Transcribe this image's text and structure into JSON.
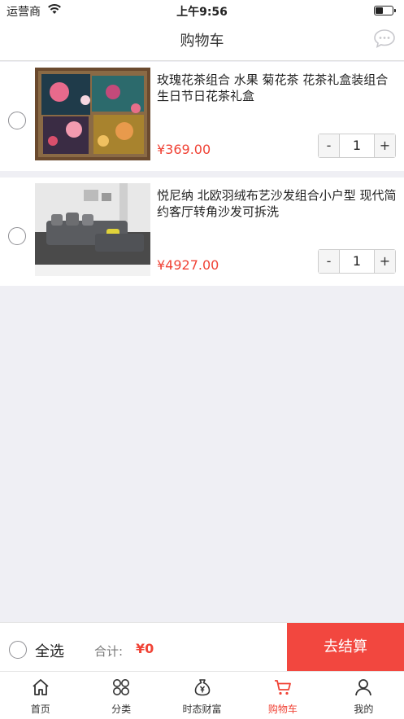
{
  "status_bar": {
    "carrier": "运营商",
    "time": "上午9:56",
    "battery_level": 0.4
  },
  "nav": {
    "title": "购物车",
    "chat_icon": "chat-bubble-icon"
  },
  "cart": {
    "items": [
      {
        "title": "玫瑰花茶组合 水果 菊花茶 花茶礼盒装组合 生日节日花茶礼盒",
        "price": "¥369.00",
        "qty": "1",
        "minus": "-",
        "plus": "+"
      },
      {
        "title": "悦尼纳 北欧羽绒布艺沙发组合小户型 现代简约客厅转角沙发可拆洗",
        "price": "¥4927.00",
        "qty": "1",
        "minus": "-",
        "plus": "+"
      }
    ]
  },
  "checkout": {
    "select_all": "全选",
    "total_label": "合计:",
    "total_value": "¥0",
    "button": "去结算"
  },
  "tabs": [
    {
      "label": "首页",
      "icon": "home-icon"
    },
    {
      "label": "分类",
      "icon": "category-icon"
    },
    {
      "label": "时态财富",
      "icon": "money-bag-icon"
    },
    {
      "label": "购物车",
      "icon": "cart-icon"
    },
    {
      "label": "我的",
      "icon": "user-icon"
    }
  ],
  "colors": {
    "accent": "#f04336",
    "checkout_bg": "#f2473f",
    "page_bg": "#efeff4"
  }
}
